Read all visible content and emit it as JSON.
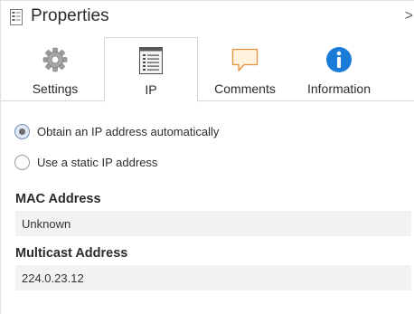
{
  "header": {
    "title": "Properties",
    "chevron": ">"
  },
  "tabs": [
    {
      "label": "Settings",
      "icon": "gear-icon",
      "active": false
    },
    {
      "label": "IP",
      "icon": "ip-list-icon",
      "active": true
    },
    {
      "label": "Comments",
      "icon": "comment-icon",
      "active": false
    },
    {
      "label": "Information",
      "icon": "info-icon",
      "active": false
    }
  ],
  "ip_mode": {
    "options": [
      {
        "label": "Obtain an IP address automatically",
        "selected": true
      },
      {
        "label": "Use a static IP address",
        "selected": false
      }
    ]
  },
  "fields": {
    "mac_address": {
      "label": "MAC Address",
      "value": "Unknown"
    },
    "multicast_address": {
      "label": "Multicast Address",
      "value": "224.0.23.12"
    }
  },
  "colors": {
    "info_blue": "#1a7bd8",
    "comment_orange": "#e8913a",
    "comment_fill": "#fff3dd",
    "field_bg": "#f2f2f2"
  }
}
